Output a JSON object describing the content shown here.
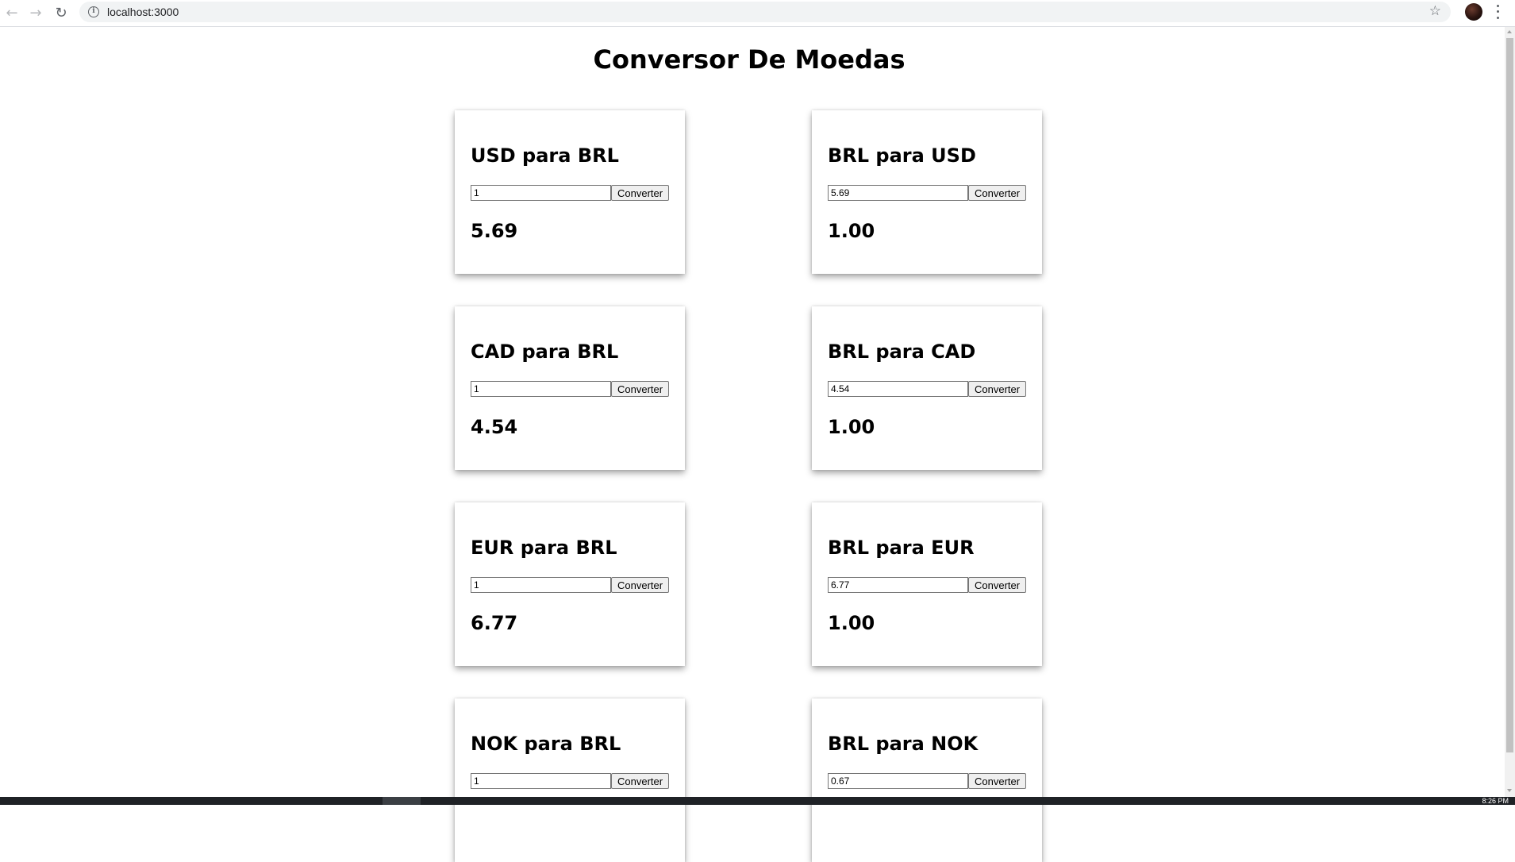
{
  "browser": {
    "url": "localhost:3000"
  },
  "page": {
    "title": "Conversor De Moedas"
  },
  "cards": [
    {
      "title": "USD para BRL",
      "input_value": "1",
      "button_label": "Converter",
      "result": "5.69"
    },
    {
      "title": "BRL para USD",
      "input_value": "5.69",
      "button_label": "Converter",
      "result": "1.00"
    },
    {
      "title": "CAD para BRL",
      "input_value": "1",
      "button_label": "Converter",
      "result": "4.54"
    },
    {
      "title": "BRL para CAD",
      "input_value": "4.54",
      "button_label": "Converter",
      "result": "1.00"
    },
    {
      "title": "EUR para BRL",
      "input_value": "1",
      "button_label": "Converter",
      "result": "6.77"
    },
    {
      "title": "BRL para EUR",
      "input_value": "6.77",
      "button_label": "Converter",
      "result": "1.00"
    },
    {
      "title": "NOK para BRL",
      "input_value": "1",
      "button_label": "Converter",
      "result": ""
    },
    {
      "title": "BRL para NOK",
      "input_value": "0.67",
      "button_label": "Converter",
      "result": ""
    }
  ],
  "taskbar": {
    "clock": "8:26 PM"
  }
}
